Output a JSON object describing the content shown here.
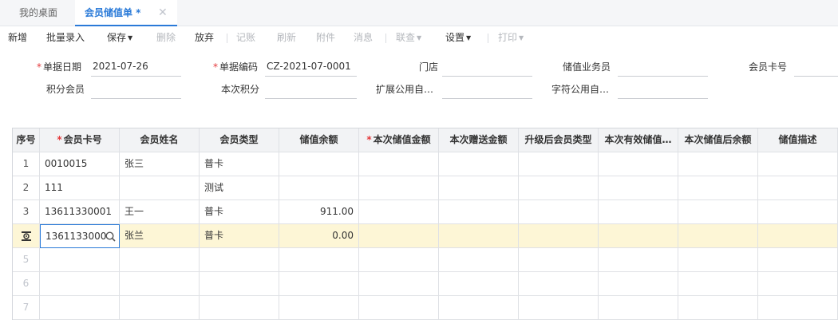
{
  "tabs": [
    {
      "label": "我的桌面"
    },
    {
      "label": "会员储值单 *",
      "close": "✕"
    }
  ],
  "toolbar": {
    "new": "新增",
    "batch": "批量录入",
    "save": "保存",
    "delete": "删除",
    "discard": "放弃",
    "post": "记账",
    "refresh": "刷新",
    "attachment": "附件",
    "message": "消息",
    "link_query": "联查",
    "settings": "设置",
    "print": "打印"
  },
  "form": {
    "required_mark": "*",
    "doc_date_label": "单据日期",
    "doc_date_value": "2021-07-26",
    "doc_code_label": "单据编码",
    "doc_code_value": "CZ-2021-07-0001",
    "store_label": "门店",
    "store_value": "",
    "salesman_label": "储值业务员",
    "salesman_value": "",
    "card_label": "会员卡号",
    "card_value": "",
    "points_member_label": "积分会员",
    "points_member_value": "",
    "current_points_label": "本次积分",
    "current_points_value": "",
    "ext_common_label": "扩展公用自…",
    "ext_common_value": "",
    "char_common_label": "字符公用自…",
    "char_common_value": ""
  },
  "grid": {
    "columns": [
      "序号",
      "会员卡号",
      "会员姓名",
      "会员类型",
      "储值余额",
      "本次储值金额",
      "本次赠送金额",
      "升级后会员类型",
      "本次有效储值…",
      "本次储值后余额",
      "储值描述"
    ],
    "rows": [
      {
        "seq": "1",
        "card": "0010015",
        "name": "张三",
        "type": "普卡",
        "balance": ""
      },
      {
        "seq": "2",
        "card": "111",
        "name": "",
        "type": "测试",
        "balance": ""
      },
      {
        "seq": "3",
        "card": "13611330001",
        "name": "王一",
        "type": "普卡",
        "balance": "911.00"
      },
      {
        "seq": "",
        "card": "1361133000",
        "name": "张兰",
        "type": "普卡",
        "balance": "0.00"
      },
      {
        "seq": "5",
        "card": "",
        "name": "",
        "type": "",
        "balance": ""
      },
      {
        "seq": "6",
        "card": "",
        "name": "",
        "type": "",
        "balance": ""
      },
      {
        "seq": "7",
        "card": "",
        "name": "",
        "type": "",
        "balance": ""
      }
    ]
  },
  "colors": {
    "accent": "#2a7ad8",
    "required": "#e4393c",
    "highlight_row": "#fdf6d6"
  }
}
